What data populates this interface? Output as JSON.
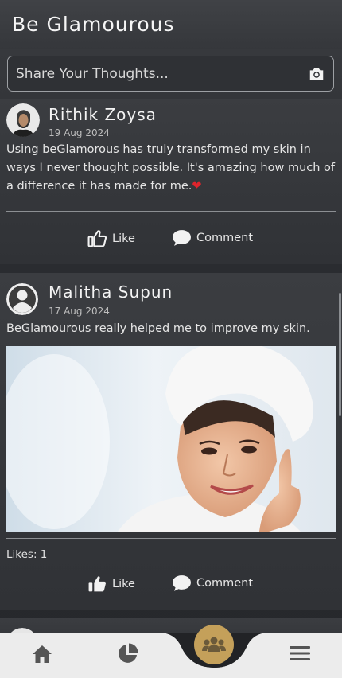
{
  "app": {
    "title": "Be Glamourous"
  },
  "composer": {
    "placeholder": "Share Your Thoughts...",
    "camera_icon": "camera-icon"
  },
  "posts": [
    {
      "author": "Rithik Zoysa",
      "date": "19 Aug 2024",
      "text": "Using beGlamorous has truly transformed my skin in ways I never thought possible. It's amazing how much of a difference it has made for me.",
      "emoji": "❤",
      "like_label": "Like",
      "comment_label": "Comment"
    },
    {
      "author": "Malitha Supun",
      "date": "17 Aug 2024",
      "text": "BeGlamourous really helped me to improve my skin.",
      "likes": "Likes: 1",
      "like_label": "Like",
      "comment_label": "Comment"
    }
  ],
  "nav": {
    "items": [
      "home-icon",
      "pie-chart-icon",
      "community-icon",
      "menu-icon"
    ],
    "accent": "#c4a05a",
    "background": "#ececec"
  }
}
